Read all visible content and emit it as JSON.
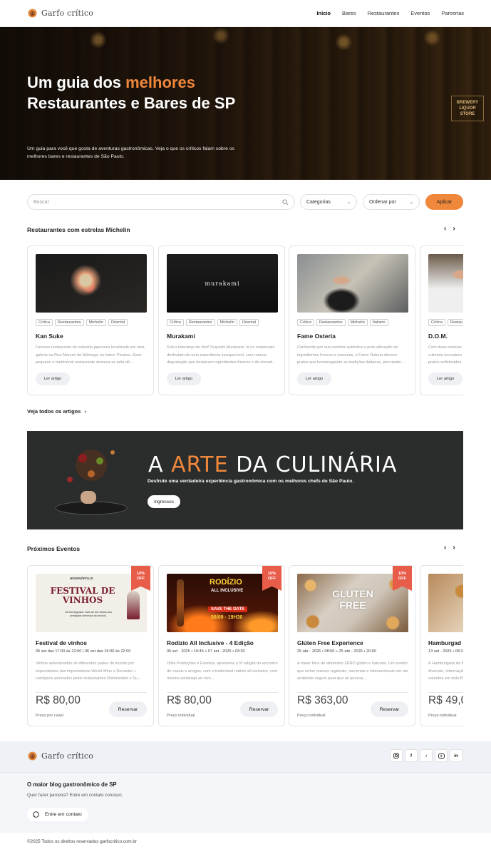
{
  "brand": {
    "name": "Garfo crítico"
  },
  "nav": {
    "items": [
      {
        "label": "Início",
        "active": true
      },
      {
        "label": "Bares"
      },
      {
        "label": "Restaurantes"
      },
      {
        "label": "Eventos"
      },
      {
        "label": "Parcerias"
      }
    ]
  },
  "hero": {
    "title_part1": "Um guia dos ",
    "title_highlight": "melhores",
    "title_line2": "Restaurantes e Bares de SP",
    "subtitle": "Um guia para você que gosta de aventuras gastronômicas. Veja o que os críticos falam sobre os melhores bares e restaurantes de São Paulo.",
    "sign_text": "BREWERY LIQUOR STORE"
  },
  "filters": {
    "search_placeholder": "Buscar",
    "categories": "Categorias",
    "order": "Ordenar por",
    "apply": "Aplicar"
  },
  "michelin": {
    "title": "Restaurantes com estrelas Michelin",
    "see_all": "Veja todos os artigos",
    "read_label": "Ler artigo",
    "cards": [
      {
        "name": "Kan Suke",
        "tags": [
          "Crítica",
          "Restaurantes",
          "Michelin",
          "Oriental"
        ],
        "desc": "Famoso restaurante de culinária japonesa localizado em uma galeria na Rua Manuel da Nóbrega, no bairro Paraíso. Esse pequeno e tradicional restaurante destaca-se pela alt..."
      },
      {
        "name": "Murakami",
        "tags": [
          "Crítica",
          "Restaurantes",
          "Michelin",
          "Oriental"
        ],
        "desc": "Sob a liderança do chef Tsuyoshi Murakami, lá os comensais desfrutam de uma experiência inesquecível, com menus degustação que destacam ingredientes frescos e de elevad...",
        "img_text": "murakami"
      },
      {
        "name": "Fame Osteria",
        "tags": [
          "Crítica",
          "Restaurantes",
          "Michelin",
          "Italiano"
        ],
        "desc": "Conhecido por sua cozinha autêntica e pela utilização de ingredientes frescos e sazonais, o Fame Osteria oferece pratos que homenageiam as tradições italianas, principalm..."
      },
      {
        "name": "D.O.M.",
        "tags": [
          "Crítica",
          "Restau"
        ],
        "desc": "Com duas estrelas culinária inovadora pratos sofisticados"
      }
    ]
  },
  "banner": {
    "title_a": "A ",
    "title_highlight": "ARTE",
    "title_b": " DA CULINÁRIA",
    "subtitle": "Desfrute uma verdadeira experiência gastronômica com os melhores chefs de São Paulo.",
    "button": "ingressos"
  },
  "events": {
    "title": "Próximos Eventos",
    "reserve_label": "Reservar",
    "cards": [
      {
        "badge_pct": "10%",
        "badge_off": "OFF",
        "name": "Festival de vinhos",
        "date": "05 set das 17:00 às 22:00 | 06 set das 15:00 às 22:00",
        "desc": "Vinhos selecionados de diferentes partes do mundo por especialistas das importadoras World Wine e Decanter + cardápios assinados pelos restaurantes Ristorantino e Su...",
        "price": "R$ 80,00",
        "price_label": "Preço por casal",
        "img_title": "FESTIVAL DE VINHOS",
        "img_small": "HIGIENÓPOLIS",
        "img_caption": "Venha degustar mais de 30 rótulos dos principais vinhedos do mundo."
      },
      {
        "badge_pct": "10%",
        "badge_off": "OFF",
        "name": "Rodizio All Inclusive - 4 Edição",
        "date": "06 set · 2025 • 19:45 » 07 set · 2025 • 03:30",
        "desc": "Orbe Produções e Eventos, apresenta a 5ª edição do encontro de casais e amigos, com o tradicional rodízio all inclusive, com música sertaneja ao vivo...",
        "price": "R$ 80,00",
        "price_label": "Preço individual",
        "img_title": "RODÍZIO",
        "img_sub": "ALL INCLUSIVE",
        "img_save": "SAVE THE DATE",
        "img_date": "06/09 - 19H30"
      },
      {
        "badge_pct": "10%",
        "badge_off": "OFF",
        "name": "Glúten Free Experience",
        "date": "25 abr - 2026 • 08:00 » 25 abr - 2026 • 20:00",
        "desc": "A maior feira de alimentos ZERO glúten e naturais. Um evento que reúne marcas regionais, nacionais e internacionais em um ambiente seguro para que as pessoa...",
        "price": "R$ 363,00",
        "price_label": "Preço individual",
        "img_title": "GLUTEN FREE"
      },
      {
        "name": "Hamburgad",
        "date": "13 set - 2025 • 08:3",
        "desc": "A Hamburgada do Bar diversão, informaçã carentes em todo B...",
        "price": "R$ 49,0",
        "price_label": "Preço individual"
      }
    ]
  },
  "footer": {
    "social": [
      "instagram-icon",
      "facebook-icon",
      "tiktok-icon",
      "youtube-icon",
      "linkedin-icon"
    ],
    "heading": "O maior blog gastronômico de SP",
    "sub": "Quer fazer parceira? Entre em contato conosco.",
    "contact": "Entre em contato",
    "copyright": "©2025 Todos os direitos reservados garfocritico.com.br"
  },
  "colors": {
    "accent": "#f0883c",
    "badge": "#e85c4a",
    "banner_bg": "#2b2c2c"
  }
}
